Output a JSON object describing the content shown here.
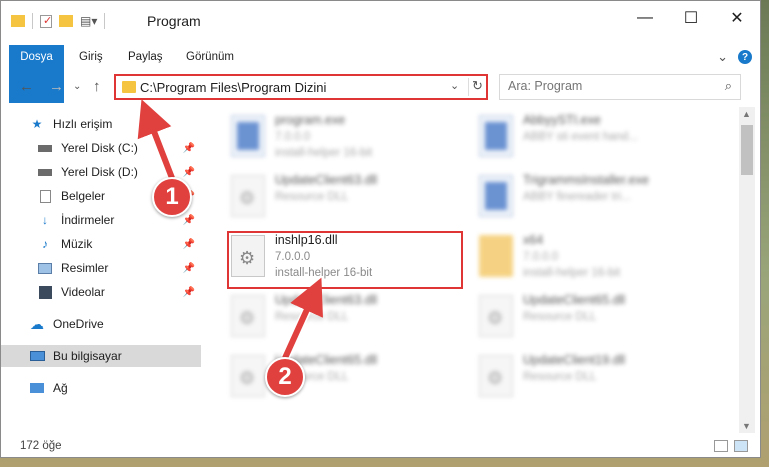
{
  "window": {
    "title": "Program"
  },
  "controls": {
    "minimize": "—",
    "maximize": "☐",
    "close": "✕"
  },
  "ribbon": {
    "tabs": [
      "Dosya",
      "Giriş",
      "Paylaş",
      "Görünüm"
    ],
    "expand": "⌄",
    "help": "?"
  },
  "nav": {
    "back": "←",
    "forward": "→",
    "recent": "⌄",
    "up": "↑",
    "address": "C:\\Program Files\\Program Dizini",
    "address_dropdown": "⌄",
    "refresh": "↻",
    "search_placeholder": "Ara: Program"
  },
  "sidebar": {
    "items": [
      {
        "label": "Hızlı erişim",
        "icon": "star-icon",
        "pinned": false
      },
      {
        "label": "Yerel Disk (C:)",
        "icon": "drive-icon",
        "pinned": true
      },
      {
        "label": "Yerel Disk (D:)",
        "icon": "drive-icon",
        "pinned": true
      },
      {
        "label": "Belgeler",
        "icon": "documents-icon",
        "pinned": true
      },
      {
        "label": "İndirmeler",
        "icon": "download-icon",
        "pinned": true
      },
      {
        "label": "Müzik",
        "icon": "music-icon",
        "pinned": true
      },
      {
        "label": "Resimler",
        "icon": "pictures-icon",
        "pinned": true
      },
      {
        "label": "Videolar",
        "icon": "videos-icon",
        "pinned": true
      },
      {
        "label": "OneDrive",
        "icon": "cloud-icon",
        "pinned": false
      },
      {
        "label": "Bu bilgisayar",
        "icon": "computer-icon",
        "pinned": false,
        "selected": true
      },
      {
        "label": "Ağ",
        "icon": "network-icon",
        "pinned": false
      }
    ]
  },
  "files": [
    {
      "name": "program.exe",
      "line2": "7.0.0.0",
      "line3": "install-helper 16-bit",
      "type": "exe"
    },
    {
      "name": "AbbyySTI.exe",
      "line2": "ABBY sti event hand...",
      "line3": "",
      "type": "exe"
    },
    {
      "name": "UpdateClient63.dll",
      "line2": "Resource DLL",
      "line3": "",
      "type": "dll"
    },
    {
      "name": "TrigrammsInstaller.exe",
      "line2": "ABBY finereader tri...",
      "line3": "",
      "type": "exe"
    },
    {
      "name": "inshlp16.dll",
      "line2": "7.0.0.0",
      "line3": "install-helper 16-bit",
      "type": "dll",
      "highlighted": true
    },
    {
      "name": "x64",
      "line2": "7.0.0.0",
      "line3": "install-helper 16-bit",
      "type": "folder"
    },
    {
      "name": "UpdateClient63.dll",
      "line2": "Resource DLL",
      "line3": "",
      "type": "dll"
    },
    {
      "name": "UpdateClient65.dll",
      "line2": "Resource DLL",
      "line3": "",
      "type": "dll"
    },
    {
      "name": "UpdateClient65.dll",
      "line2": "Resource DLL",
      "line3": "",
      "type": "dll"
    },
    {
      "name": "UpdateClient19.dll",
      "line2": "Resource DLL",
      "line3": "",
      "type": "dll"
    }
  ],
  "status": {
    "count": "172 öğe"
  },
  "annotations": {
    "step1": "1",
    "step2": "2"
  },
  "colors": {
    "accent": "#1979ca",
    "highlight": "#e03535"
  }
}
